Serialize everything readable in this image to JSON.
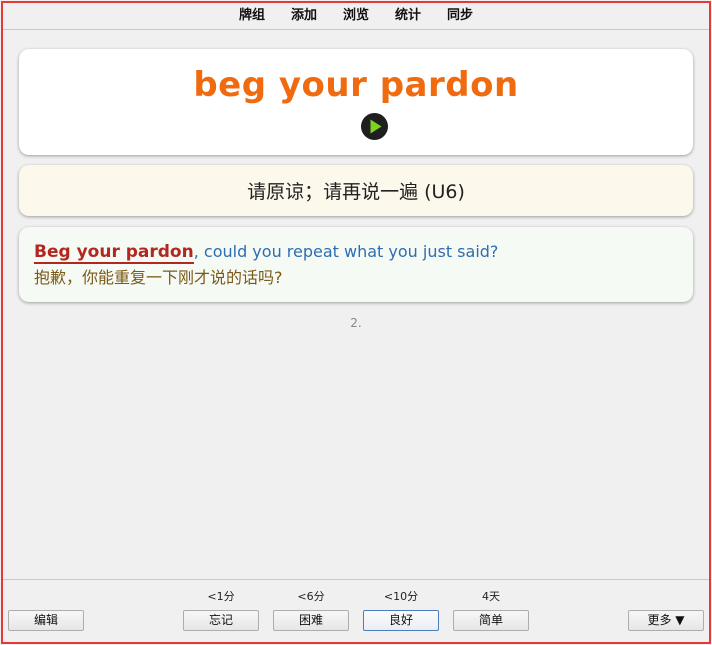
{
  "menu": {
    "decks": "牌组",
    "add": "添加",
    "browse": "浏览",
    "stats": "统计",
    "sync": "同步"
  },
  "card": {
    "word": "beg your pardon",
    "definition": "请原谅；请再说一遍 (U6)",
    "example_head": "Beg your pardon",
    "example_rest": ", could you repeat what you just said?",
    "example_zh": "抱歉，你能重复一下刚才说的话吗?",
    "index": "2."
  },
  "bottom": {
    "edit": "编辑",
    "more": "更多 ▼",
    "answers": [
      {
        "interval": "<1分",
        "label": "忘记"
      },
      {
        "interval": "<6分",
        "label": "困难"
      },
      {
        "interval": "<10分",
        "label": "良好"
      },
      {
        "interval": "4天",
        "label": "简单"
      }
    ]
  },
  "colors": {
    "word": "#f06a10",
    "example_head": "#b2271f",
    "example_en": "#2d6db1",
    "example_zh": "#7a5a18",
    "frame": "#e53935"
  },
  "icons": {
    "play": "play-audio-icon"
  }
}
